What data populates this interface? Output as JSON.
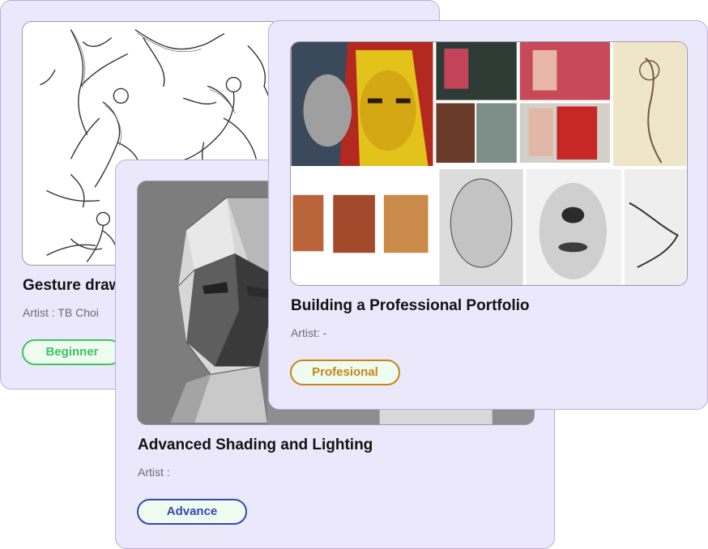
{
  "cards": [
    {
      "title": "Gesture drawing",
      "artist": "Artist : TB Choi",
      "level": "Beginner",
      "level_color": "#3cc461",
      "level_bg": "#eefbef",
      "image_icon": "gesture-sketch-image"
    },
    {
      "title": "Advanced Shading and Lighting",
      "artist": "Artist :",
      "level": "Advance",
      "level_color": "#2f49b8",
      "level_bg": "#eefbef",
      "image_icon": "shaded-head-image"
    },
    {
      "title": "Building a Professional Portfolio",
      "artist": "Artist: -",
      "level": "Profesional",
      "level_color": "#c88416",
      "level_bg": "#eefbef",
      "image_icon": "portfolio-collage-image"
    }
  ],
  "colors": {
    "card_bg": "#ece8fb",
    "card_border": "#b9aee0"
  }
}
